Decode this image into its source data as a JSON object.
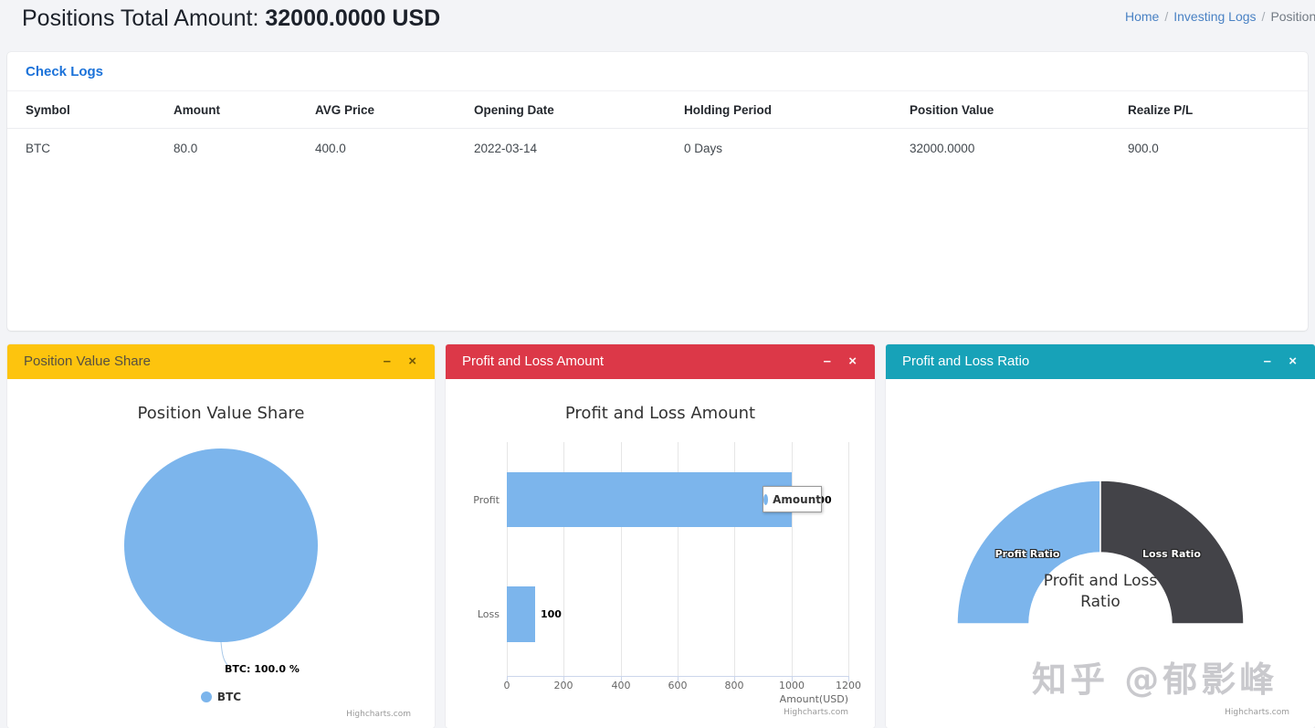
{
  "header": {
    "title_label": "Positions Total Amount:",
    "title_value": "32000.0000 USD"
  },
  "breadcrumb": {
    "home": "Home",
    "sep": "/",
    "investing_logs": "Investing Logs",
    "current": "Position"
  },
  "logs_card": {
    "link_label": "Check Logs",
    "headers": [
      "Symbol",
      "Amount",
      "AVG Price",
      "Opening Date",
      "Holding Period",
      "Position Value",
      "Realize P/L"
    ],
    "rows": [
      [
        "BTC",
        "80.0",
        "400.0",
        "2022-03-14",
        "0 Days",
        "32000.0000",
        "900.0"
      ]
    ]
  },
  "icons": {
    "minimize": "–",
    "close": "×"
  },
  "credit": "Highcharts.com",
  "watermark": "知乎 @郁影峰",
  "panels": {
    "pie": {
      "header": "Position Value Share",
      "chart_title": "Position Value Share",
      "point_label": "BTC: 100.0 %",
      "legend": "BTC"
    },
    "bar": {
      "header": "Profit and Loss Amount",
      "chart_title": "Profit and Loss Amount",
      "categories": [
        "Profit",
        "Loss"
      ],
      "x_ticks": [
        "0",
        "200",
        "400",
        "600",
        "800",
        "1000",
        "1200"
      ],
      "data_labels": [
        "1000",
        "100"
      ],
      "legend": "Amount",
      "axis_title": "Amount(USD)"
    },
    "gauge": {
      "header": "Profit and Loss Ratio",
      "center_title_line1": "Profit and Loss",
      "center_title_line2": "Ratio",
      "slice_labels": [
        "Profit Ratio",
        "Loss Ratio"
      ]
    }
  },
  "colors": {
    "accent_yellow": "#fdc40e",
    "accent_red": "#dc3848",
    "accent_teal": "#17a2b8",
    "series_blue": "#7cb5ec",
    "series_dark": "#434348",
    "link_blue": "#1b72d9"
  },
  "chart_data": [
    {
      "type": "pie",
      "title": "Position Value Share",
      "labels": [
        "BTC"
      ],
      "values": [
        100.0
      ],
      "unit": "%",
      "colors": [
        "#7cb5ec"
      ],
      "legend_position": "bottom",
      "point_label": "BTC: 100.0 %"
    },
    {
      "type": "bar",
      "orientation": "horizontal",
      "title": "Profit and Loss Amount",
      "categories": [
        "Profit",
        "Loss"
      ],
      "series": [
        {
          "name": "Amount",
          "values": [
            1000,
            100
          ]
        }
      ],
      "xlabel": "Amount(USD)",
      "xlim": [
        0,
        1200
      ],
      "x_ticks": [
        0,
        200,
        400,
        600,
        800,
        1000,
        1200
      ],
      "grid": true,
      "color": "#7cb5ec",
      "legend_position": "floating-over-plot"
    },
    {
      "type": "pie",
      "subtype": "semi-circle-donut",
      "title": "Profit and Loss Ratio",
      "labels": [
        "Profit Ratio",
        "Loss Ratio"
      ],
      "values": [
        50,
        50
      ],
      "unit": "%",
      "colors": [
        "#7cb5ec",
        "#434348"
      ],
      "center_title": "Profit and Loss Ratio"
    }
  ]
}
